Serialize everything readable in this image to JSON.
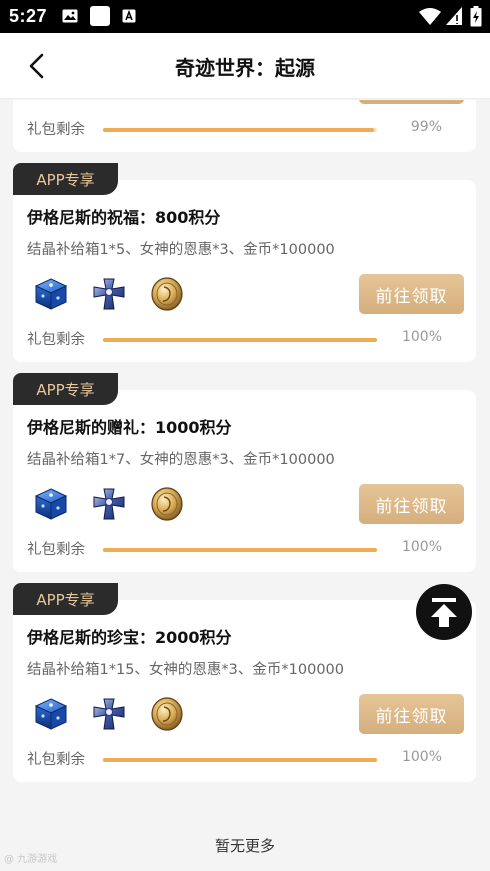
{
  "status_bar": {
    "time": "5:27"
  },
  "header": {
    "title": "奇迹世界：起源"
  },
  "top_partial_card": {
    "remain_label": "礼包剩余",
    "percent_text": "99%",
    "progress": 0.99
  },
  "cards": [
    {
      "tag": "APP专享",
      "title": "伊格尼斯的祝福：800积分",
      "desc": "结晶补给箱1*5、女神的恩惠*3、金币*100000",
      "button_label": "前往领取",
      "remain_label": "礼包剩余",
      "percent_text": "100%",
      "progress": 1.0
    },
    {
      "tag": "APP专享",
      "title": "伊格尼斯的赠礼：1000积分",
      "desc": "结晶补给箱1*7、女神的恩惠*3、金币*100000",
      "button_label": "前往领取",
      "remain_label": "礼包剩余",
      "percent_text": "100%",
      "progress": 1.0
    },
    {
      "tag": "APP专享",
      "title": "伊格尼斯的珍宝：2000积分",
      "desc": "结晶补给箱1*15、女神的恩惠*3、金币*100000",
      "button_label": "前往领取",
      "remain_label": "礼包剩余",
      "percent_text": "100%",
      "progress": 1.0
    }
  ],
  "footer": {
    "no_more": "暂无更多"
  },
  "watermark": "@ 九游游戏",
  "icons": [
    "back-arrow-icon",
    "crystal-box-icon",
    "blue-cross-icon",
    "gold-coin-icon",
    "back-to-top-icon"
  ],
  "colors": {
    "accent_gold": "#d8b27f",
    "progress": "#efac55",
    "tag_bg": "#2b2b2b",
    "tag_text": "#e8c79a"
  }
}
